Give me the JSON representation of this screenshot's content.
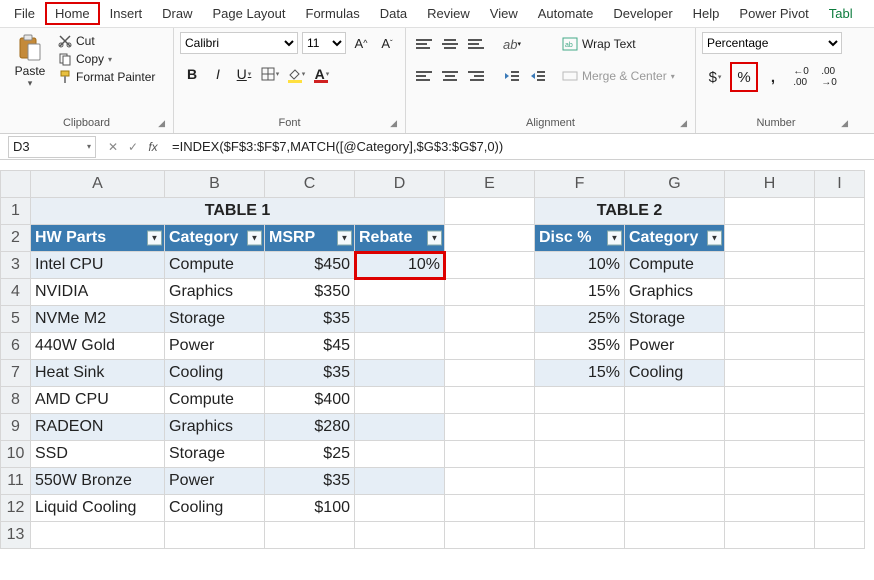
{
  "menu": {
    "items": [
      "File",
      "Home",
      "Insert",
      "Draw",
      "Page Layout",
      "Formulas",
      "Data",
      "Review",
      "View",
      "Automate",
      "Developer",
      "Help",
      "Power Pivot",
      "Tabl"
    ],
    "highlighted_index": 1
  },
  "ribbon": {
    "clipboard": {
      "paste": "Paste",
      "cut": "Cut",
      "copy": "Copy",
      "format_painter": "Format Painter",
      "title": "Clipboard"
    },
    "font": {
      "name": "Calibri",
      "size": "11",
      "title": "Font"
    },
    "alignment": {
      "wrap": "Wrap Text",
      "merge": "Merge & Center",
      "title": "Alignment"
    },
    "number": {
      "format": "Percentage",
      "title": "Number"
    }
  },
  "formula_bar": {
    "name_box": "D3",
    "fx_label": "fx",
    "formula": "=INDEX($F$3:$F$7,MATCH([@Category],$G$3:$G$7,0))"
  },
  "columns": [
    "A",
    "B",
    "C",
    "D",
    "E",
    "F",
    "G",
    "H",
    "I"
  ],
  "table1": {
    "title": "TABLE 1",
    "headers": [
      "HW Parts",
      "Category",
      "MSRP",
      "Rebate"
    ],
    "rows": [
      {
        "part": "Intel CPU",
        "category": "Compute",
        "msrp": "$450",
        "rebate": "10%"
      },
      {
        "part": "NVIDIA",
        "category": "Graphics",
        "msrp": "$350",
        "rebate": ""
      },
      {
        "part": "NVMe M2",
        "category": "Storage",
        "msrp": "$35",
        "rebate": ""
      },
      {
        "part": "440W Gold",
        "category": "Power",
        "msrp": "$45",
        "rebate": ""
      },
      {
        "part": "Heat Sink",
        "category": "Cooling",
        "msrp": "$35",
        "rebate": ""
      },
      {
        "part": "AMD CPU",
        "category": "Compute",
        "msrp": "$400",
        "rebate": ""
      },
      {
        "part": "RADEON",
        "category": "Graphics",
        "msrp": "$280",
        "rebate": ""
      },
      {
        "part": "SSD",
        "category": "Storage",
        "msrp": "$25",
        "rebate": ""
      },
      {
        "part": "550W Bronze",
        "category": "Power",
        "msrp": "$35",
        "rebate": ""
      },
      {
        "part": "Liquid Cooling",
        "category": "Cooling",
        "msrp": "$100",
        "rebate": ""
      }
    ]
  },
  "table2": {
    "title": "TABLE 2",
    "headers": [
      "Disc %",
      "Category"
    ],
    "rows": [
      {
        "disc": "10%",
        "category": "Compute"
      },
      {
        "disc": "15%",
        "category": "Graphics"
      },
      {
        "disc": "25%",
        "category": "Storage"
      },
      {
        "disc": "35%",
        "category": "Power"
      },
      {
        "disc": "15%",
        "category": "Cooling"
      }
    ]
  }
}
